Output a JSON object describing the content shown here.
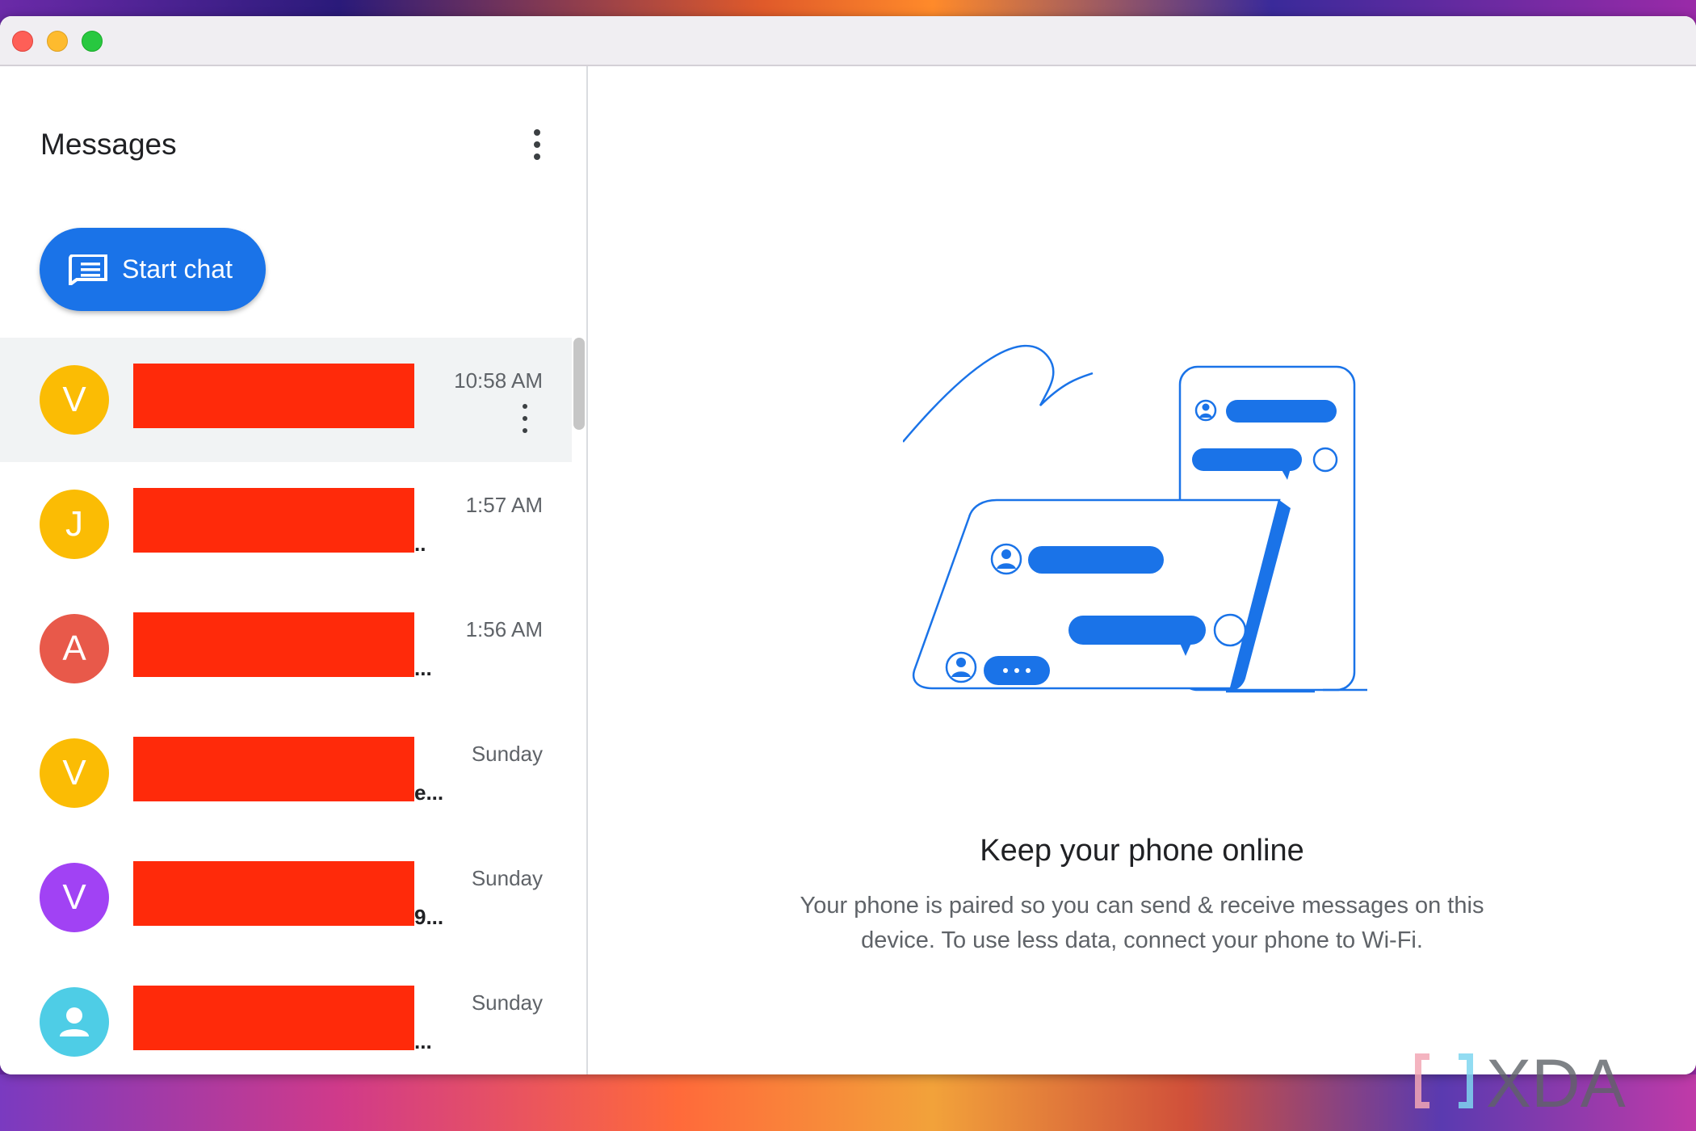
{
  "app": {
    "title": "Messages",
    "start_chat_label": "Start chat"
  },
  "conversations": [
    {
      "avatar_letter": "V",
      "avatar_color": "#fbbc04",
      "snippet_tail": "",
      "time": "10:58 AM",
      "selected": true
    },
    {
      "avatar_letter": "J",
      "avatar_color": "#fbbc04",
      "snippet_tail": "..",
      "time": "1:57 AM"
    },
    {
      "avatar_letter": "A",
      "avatar_color": "#e8594a",
      "snippet_tail": "...",
      "time": "1:56 AM"
    },
    {
      "avatar_letter": "V",
      "avatar_color": "#fbbc04",
      "snippet_tail": "e...",
      "time": "Sunday"
    },
    {
      "avatar_letter": "V",
      "avatar_color": "#a142f4",
      "snippet_tail": "9...",
      "time": "Sunday"
    },
    {
      "avatar_letter": "",
      "avatar_icon": "person-icon",
      "avatar_color": "#4ecde6",
      "snippet_tail": "...",
      "time": "Sunday"
    }
  ],
  "main": {
    "heading": "Keep your phone online",
    "body": "Your phone is paired so you can send & receive messages on this device. To use less data, connect your phone to Wi-Fi."
  },
  "colors": {
    "accent": "#1a73e8",
    "redaction": "#ff2a0a"
  },
  "watermark": {
    "text": "XDA"
  }
}
